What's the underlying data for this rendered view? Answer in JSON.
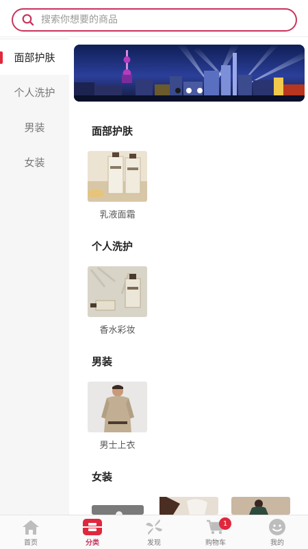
{
  "search": {
    "placeholder": "搜索你想要的商品"
  },
  "sidebar": {
    "items": [
      {
        "label": "面部护肤",
        "active": true
      },
      {
        "label": "个人洗护",
        "active": false
      },
      {
        "label": "男装",
        "active": false
      },
      {
        "label": "女装",
        "active": false
      }
    ]
  },
  "content": {
    "sections": [
      {
        "title": "面部护肤",
        "products": [
          {
            "label": "乳液面霜"
          }
        ]
      },
      {
        "title": "个人洗护",
        "products": [
          {
            "label": "香水彩妆"
          }
        ]
      },
      {
        "title": "男装",
        "products": [
          {
            "label": "男士上衣"
          }
        ]
      },
      {
        "title": "女装",
        "products": []
      }
    ]
  },
  "tabbar": {
    "items": [
      {
        "label": "首页",
        "icon": "home-icon"
      },
      {
        "label": "分类",
        "icon": "category-icon",
        "active": true
      },
      {
        "label": "发现",
        "icon": "discover-icon"
      },
      {
        "label": "购物车",
        "icon": "cart-icon",
        "badge": "1"
      },
      {
        "label": "我的",
        "icon": "profile-icon"
      }
    ]
  },
  "colors": {
    "accent": "#c9325a",
    "badge": "#e0283c",
    "sidebar_bg": "#f6f6f6"
  }
}
